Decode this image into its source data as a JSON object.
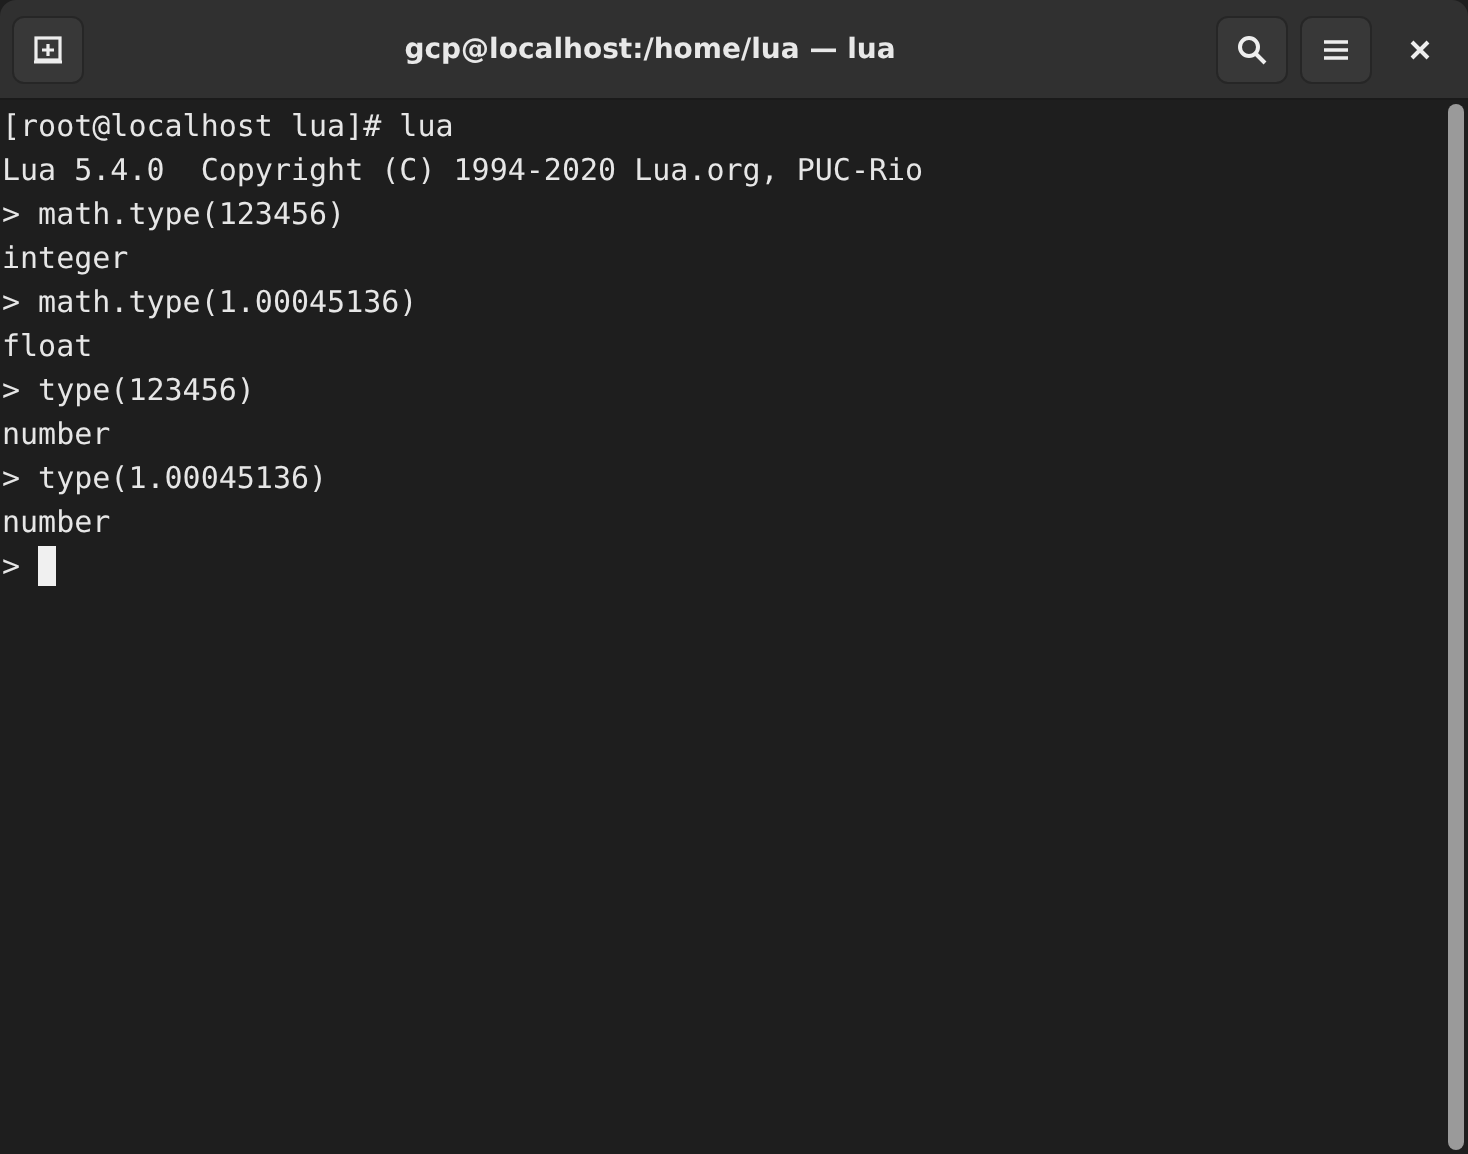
{
  "window": {
    "title": "gcp@localhost:/home/lua — lua"
  },
  "terminal": {
    "lines": [
      "[root@localhost lua]# lua",
      "Lua 5.4.0  Copyright (C) 1994-2020 Lua.org, PUC-Rio",
      "> math.type(123456)",
      "integer",
      "> math.type(1.00045136)",
      "float",
      "> type(123456)",
      "number",
      "> type(1.00045136)",
      "number"
    ],
    "prompt": ">"
  }
}
